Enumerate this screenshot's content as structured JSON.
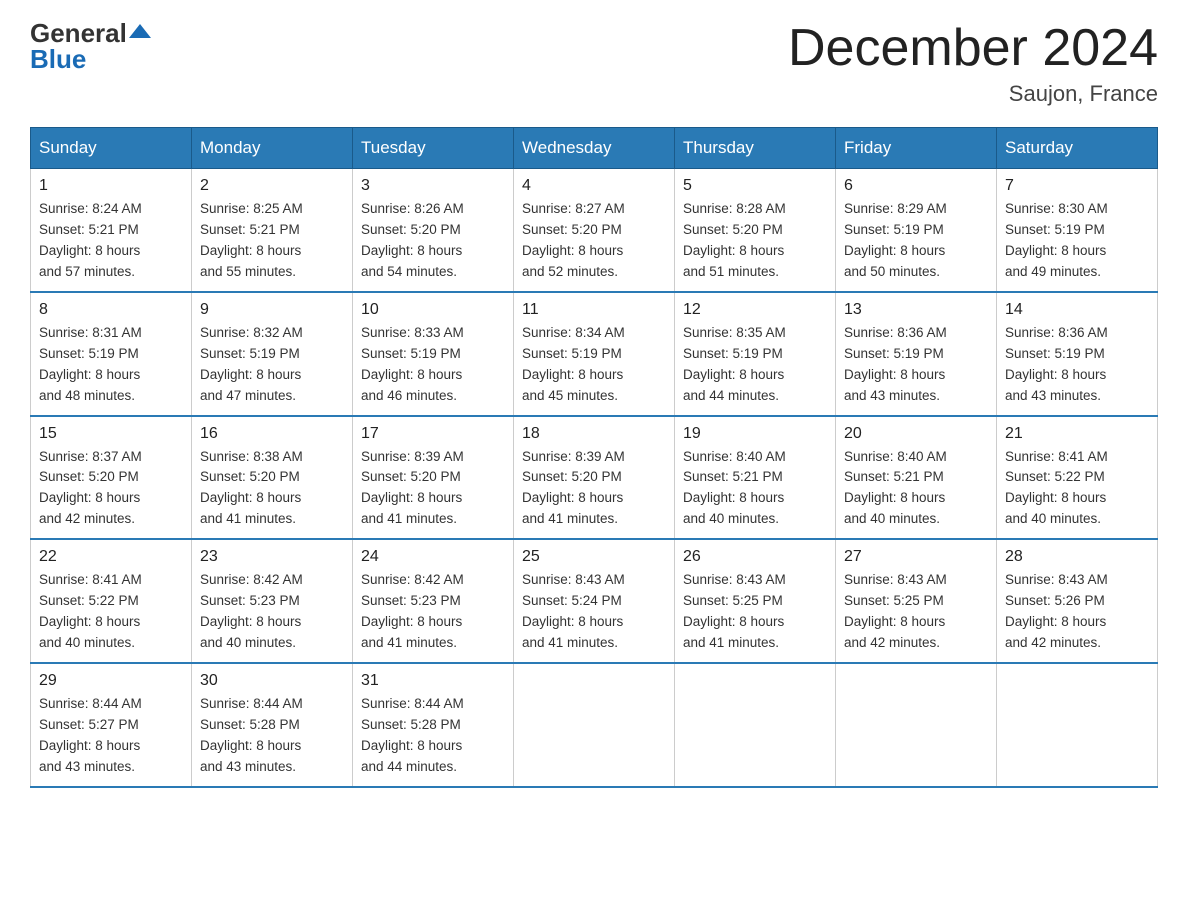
{
  "header": {
    "logo_general": "General",
    "logo_blue": "Blue",
    "month_year": "December 2024",
    "location": "Saujon, France"
  },
  "days_of_week": [
    "Sunday",
    "Monday",
    "Tuesday",
    "Wednesday",
    "Thursday",
    "Friday",
    "Saturday"
  ],
  "weeks": [
    [
      {
        "day": "1",
        "sunrise": "8:24 AM",
        "sunset": "5:21 PM",
        "daylight": "8 hours and 57 minutes."
      },
      {
        "day": "2",
        "sunrise": "8:25 AM",
        "sunset": "5:21 PM",
        "daylight": "8 hours and 55 minutes."
      },
      {
        "day": "3",
        "sunrise": "8:26 AM",
        "sunset": "5:20 PM",
        "daylight": "8 hours and 54 minutes."
      },
      {
        "day": "4",
        "sunrise": "8:27 AM",
        "sunset": "5:20 PM",
        "daylight": "8 hours and 52 minutes."
      },
      {
        "day": "5",
        "sunrise": "8:28 AM",
        "sunset": "5:20 PM",
        "daylight": "8 hours and 51 minutes."
      },
      {
        "day": "6",
        "sunrise": "8:29 AM",
        "sunset": "5:19 PM",
        "daylight": "8 hours and 50 minutes."
      },
      {
        "day": "7",
        "sunrise": "8:30 AM",
        "sunset": "5:19 PM",
        "daylight": "8 hours and 49 minutes."
      }
    ],
    [
      {
        "day": "8",
        "sunrise": "8:31 AM",
        "sunset": "5:19 PM",
        "daylight": "8 hours and 48 minutes."
      },
      {
        "day": "9",
        "sunrise": "8:32 AM",
        "sunset": "5:19 PM",
        "daylight": "8 hours and 47 minutes."
      },
      {
        "day": "10",
        "sunrise": "8:33 AM",
        "sunset": "5:19 PM",
        "daylight": "8 hours and 46 minutes."
      },
      {
        "day": "11",
        "sunrise": "8:34 AM",
        "sunset": "5:19 PM",
        "daylight": "8 hours and 45 minutes."
      },
      {
        "day": "12",
        "sunrise": "8:35 AM",
        "sunset": "5:19 PM",
        "daylight": "8 hours and 44 minutes."
      },
      {
        "day": "13",
        "sunrise": "8:36 AM",
        "sunset": "5:19 PM",
        "daylight": "8 hours and 43 minutes."
      },
      {
        "day": "14",
        "sunrise": "8:36 AM",
        "sunset": "5:19 PM",
        "daylight": "8 hours and 43 minutes."
      }
    ],
    [
      {
        "day": "15",
        "sunrise": "8:37 AM",
        "sunset": "5:20 PM",
        "daylight": "8 hours and 42 minutes."
      },
      {
        "day": "16",
        "sunrise": "8:38 AM",
        "sunset": "5:20 PM",
        "daylight": "8 hours and 41 minutes."
      },
      {
        "day": "17",
        "sunrise": "8:39 AM",
        "sunset": "5:20 PM",
        "daylight": "8 hours and 41 minutes."
      },
      {
        "day": "18",
        "sunrise": "8:39 AM",
        "sunset": "5:20 PM",
        "daylight": "8 hours and 41 minutes."
      },
      {
        "day": "19",
        "sunrise": "8:40 AM",
        "sunset": "5:21 PM",
        "daylight": "8 hours and 40 minutes."
      },
      {
        "day": "20",
        "sunrise": "8:40 AM",
        "sunset": "5:21 PM",
        "daylight": "8 hours and 40 minutes."
      },
      {
        "day": "21",
        "sunrise": "8:41 AM",
        "sunset": "5:22 PM",
        "daylight": "8 hours and 40 minutes."
      }
    ],
    [
      {
        "day": "22",
        "sunrise": "8:41 AM",
        "sunset": "5:22 PM",
        "daylight": "8 hours and 40 minutes."
      },
      {
        "day": "23",
        "sunrise": "8:42 AM",
        "sunset": "5:23 PM",
        "daylight": "8 hours and 40 minutes."
      },
      {
        "day": "24",
        "sunrise": "8:42 AM",
        "sunset": "5:23 PM",
        "daylight": "8 hours and 41 minutes."
      },
      {
        "day": "25",
        "sunrise": "8:43 AM",
        "sunset": "5:24 PM",
        "daylight": "8 hours and 41 minutes."
      },
      {
        "day": "26",
        "sunrise": "8:43 AM",
        "sunset": "5:25 PM",
        "daylight": "8 hours and 41 minutes."
      },
      {
        "day": "27",
        "sunrise": "8:43 AM",
        "sunset": "5:25 PM",
        "daylight": "8 hours and 42 minutes."
      },
      {
        "day": "28",
        "sunrise": "8:43 AM",
        "sunset": "5:26 PM",
        "daylight": "8 hours and 42 minutes."
      }
    ],
    [
      {
        "day": "29",
        "sunrise": "8:44 AM",
        "sunset": "5:27 PM",
        "daylight": "8 hours and 43 minutes."
      },
      {
        "day": "30",
        "sunrise": "8:44 AM",
        "sunset": "5:28 PM",
        "daylight": "8 hours and 43 minutes."
      },
      {
        "day": "31",
        "sunrise": "8:44 AM",
        "sunset": "5:28 PM",
        "daylight": "8 hours and 44 minutes."
      },
      null,
      null,
      null,
      null
    ]
  ]
}
